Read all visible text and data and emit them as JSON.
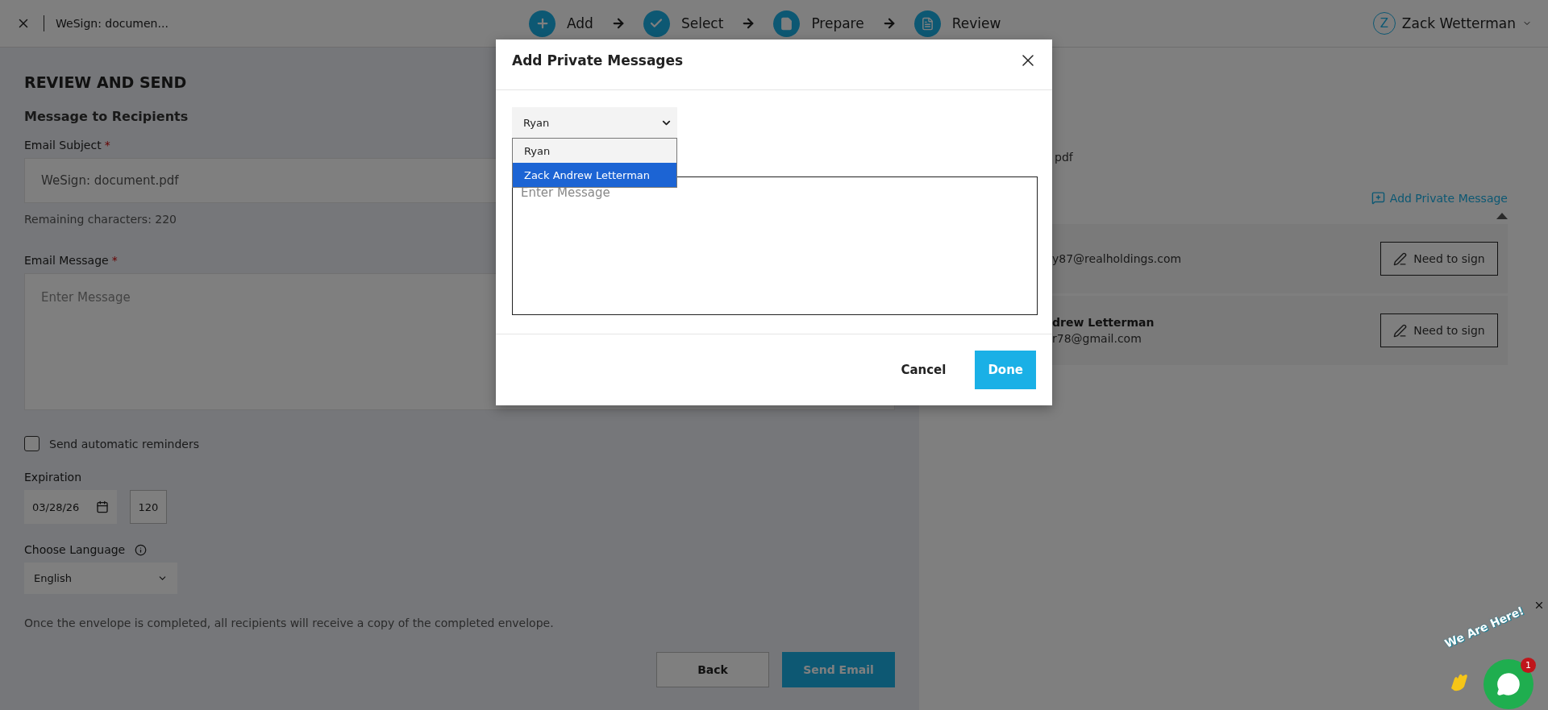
{
  "top_bar": {
    "document_title": "WeSign: documen...",
    "steps": [
      {
        "label": "Add",
        "kind": "add"
      },
      {
        "label": "Select",
        "kind": "select"
      },
      {
        "label": "Prepare",
        "kind": "prepare"
      },
      {
        "label": "Review",
        "kind": "review"
      }
    ],
    "user": {
      "initial": "Z",
      "name": "Zack Wetterman"
    }
  },
  "form": {
    "title": "REVIEW AND SEND",
    "section": "Message to Recipients",
    "subject": {
      "label": "Email Subject",
      "required_mark": "*",
      "value": "WeSign: document.pdf"
    },
    "remaining": "Remaining characters: 220",
    "message": {
      "label": "Email Message",
      "required_mark": "*",
      "placeholder": "Enter Message"
    },
    "reminders": {
      "label": "Send automatic reminders",
      "checked": false
    },
    "expiration": {
      "label": "Expiration",
      "date": "03/28/26",
      "days": "120"
    },
    "language": {
      "label": "Choose Language",
      "value": "English"
    },
    "note": "Once the envelope is completed, all recipients will receive a copy of the completed envelope.",
    "buttons": [
      {
        "label": "Back",
        "kind": "secondary"
      },
      {
        "label": "Send Email",
        "kind": "primary"
      }
    ]
  },
  "recipients_panel": {
    "file_name": "pdf",
    "add_private_message": "Add Private Message",
    "recipients": [
      {
        "email": "y87@realholdings.com",
        "action": "Need to sign"
      },
      {
        "name": "drew Letterman",
        "email": "r78@gmail.com",
        "action": "Need to sign"
      }
    ]
  },
  "modal": {
    "title": "Add Private Messages",
    "recipient_select": {
      "value": "Ryan"
    },
    "options": [
      {
        "label": "Ryan",
        "selected": false
      },
      {
        "label": "Zack Andrew Letterman",
        "selected": true
      }
    ],
    "message": {
      "placeholder": "Enter Message"
    },
    "buttons": [
      {
        "label": "Cancel",
        "kind": "secondary"
      },
      {
        "label": "Done",
        "kind": "primary"
      }
    ]
  },
  "chat": {
    "banner": "We Are Here!",
    "badge": "1"
  }
}
